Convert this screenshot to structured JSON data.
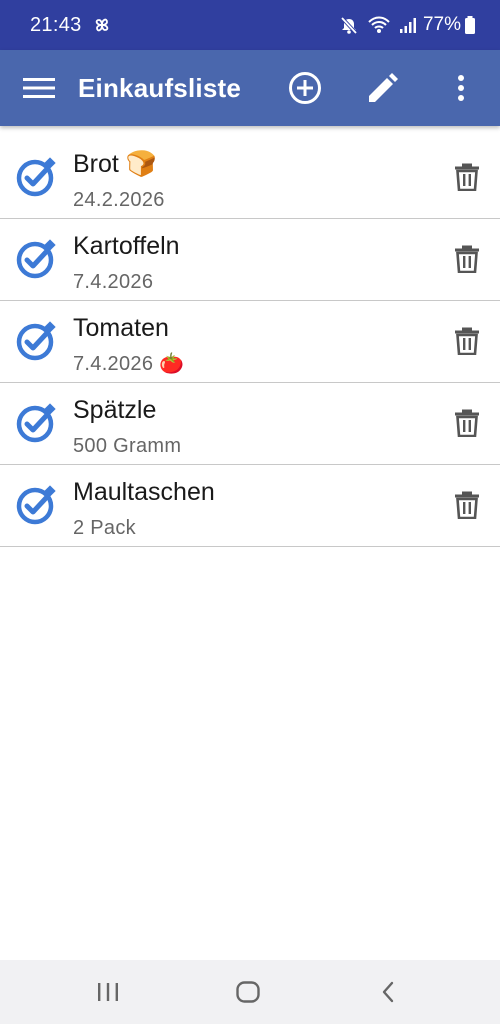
{
  "status_bar": {
    "time": "21:43",
    "battery": "77%",
    "icons": [
      "pinwheel-icon",
      "mute-icon",
      "wifi-icon",
      "signal-icon",
      "battery-icon"
    ]
  },
  "app_bar": {
    "title": "Einkaufsliste",
    "icons": [
      "menu-icon",
      "add-circle-icon",
      "edit-pencil-icon",
      "more-vert-icon"
    ]
  },
  "items": [
    {
      "name": "Brot",
      "name_emoji": "🍞",
      "detail": "24.2.2026",
      "detail_emoji": ""
    },
    {
      "name": "Kartoffeln",
      "name_emoji": "",
      "detail": "7.4.2026",
      "detail_emoji": ""
    },
    {
      "name": "Tomaten",
      "name_emoji": "",
      "detail": "7.4.2026",
      "detail_emoji": "🍅"
    },
    {
      "name": "Spätzle",
      "name_emoji": "",
      "detail": "500 Gramm",
      "detail_emoji": ""
    },
    {
      "name": "Maultaschen",
      "name_emoji": "",
      "detail": "2 Pack",
      "detail_emoji": ""
    }
  ],
  "colors": {
    "status_bar": "#303f9f",
    "app_bar": "#4a67ad",
    "check_blue": "#3d7ad6",
    "nav_bar": "#f1f1f3"
  }
}
